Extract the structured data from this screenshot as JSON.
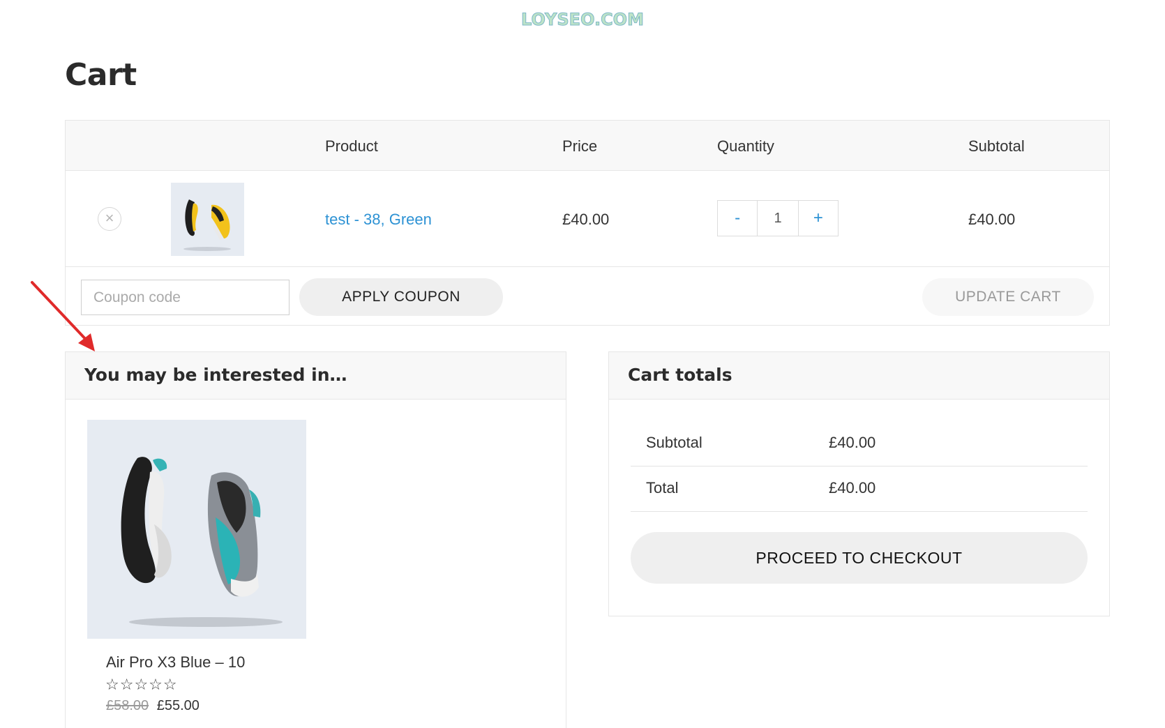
{
  "watermark": "LOYSEO.COM",
  "page": {
    "title": "Cart"
  },
  "cart_table": {
    "headers": {
      "product": "Product",
      "price": "Price",
      "quantity": "Quantity",
      "subtotal": "Subtotal"
    },
    "items": [
      {
        "remove_icon": "close-icon",
        "name": "test - 38, Green",
        "price": "£40.00",
        "quantity": "1",
        "minus": "-",
        "plus": "+",
        "subtotal": "£40.00"
      }
    ]
  },
  "actions": {
    "coupon_placeholder": "Coupon code",
    "apply_label": "APPLY COUPON",
    "update_label": "UPDATE CART"
  },
  "cross_sells": {
    "title": "You may be interested in…",
    "product": {
      "name": "Air Pro X3 Blue – 10",
      "rating": 0,
      "stars": "☆☆☆☆☆",
      "old_price": "£58.00",
      "price": "£55.00"
    }
  },
  "totals": {
    "title": "Cart totals",
    "rows": [
      {
        "label": "Subtotal",
        "value": "£40.00"
      },
      {
        "label": "Total",
        "value": "£40.00"
      }
    ],
    "checkout_label": "PROCEED TO CHECKOUT"
  },
  "colors": {
    "link": "#2d92d4",
    "annotation_arrow": "#e02a2a"
  }
}
